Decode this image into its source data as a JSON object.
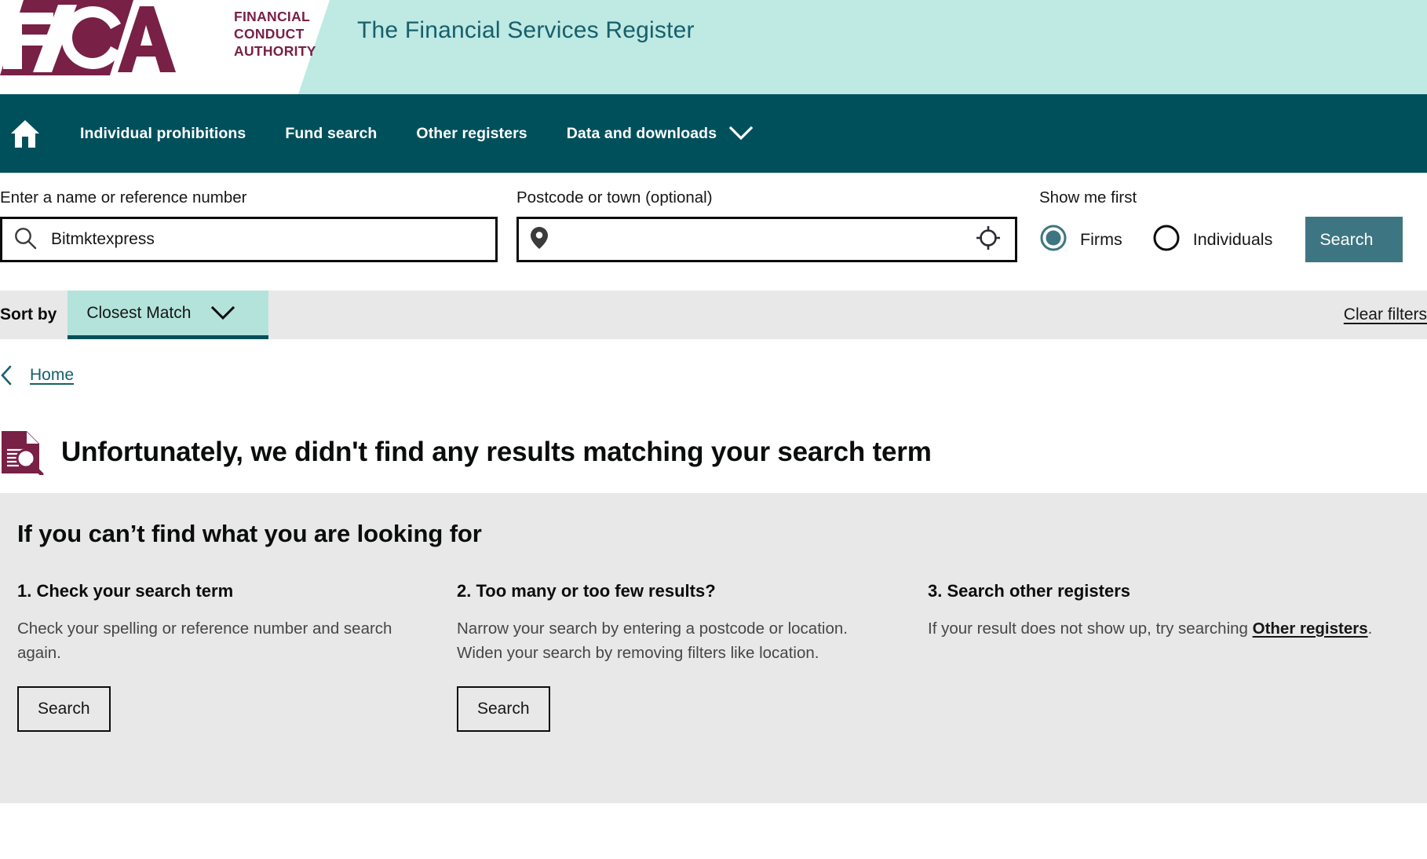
{
  "brand": {
    "logo_words": "FINANCIAL\nCONDUCT\nAUTHORITY",
    "logo_line1": "FINANCIAL",
    "logo_line2": "CONDUCT",
    "logo_line3": "AUTHORITY",
    "maroon": "#782046",
    "teal": "#00505c",
    "mint": "#bfe9e3"
  },
  "masthead": {
    "title": "The Financial Services Register"
  },
  "nav": {
    "home_icon": "home-icon",
    "items": [
      {
        "label": "Individual prohibitions",
        "caret": false
      },
      {
        "label": "Fund search",
        "caret": false
      },
      {
        "label": "Other registers",
        "caret": false
      },
      {
        "label": "Data and downloads",
        "caret": true
      }
    ]
  },
  "search": {
    "name_label": "Enter a name or reference number",
    "name_value": "Bitmktexpress",
    "name_icon": "search-icon",
    "location_label": "Postcode or town (optional)",
    "location_value": "",
    "location_placeholder": "",
    "location_icon": "map-pin-icon",
    "geolocate_icon": "crosshair-icon",
    "show_me_first_label": "Show me first",
    "options": [
      {
        "label": "Firms",
        "selected": true
      },
      {
        "label": "Individuals",
        "selected": false
      }
    ],
    "submit_label": "Search"
  },
  "sort": {
    "label": "Sort by",
    "selected": "Closest Match",
    "caret_icon": "chevron-down-icon",
    "clear_filters": "Clear filters"
  },
  "breadcrumb": {
    "back_icon": "chevron-left-icon",
    "home": "Home"
  },
  "result": {
    "icon": "document-search-icon",
    "title": "Unfortunately, we didn't find any results matching your search term"
  },
  "help": {
    "title": "If you can’t find what you are looking for",
    "columns": [
      {
        "heading": "1. Check your search term",
        "body": "Check your spelling or reference number and search again.",
        "button": "Search"
      },
      {
        "heading": "2. Too many or too few results?",
        "body": "Narrow your search by entering a postcode or location. Widen your search by removing filters like location.",
        "button": "Search"
      },
      {
        "heading": "3. Search other registers",
        "body_before": "If your result does not show up, try searching ",
        "link": "Other registers",
        "body_after": "."
      }
    ]
  }
}
